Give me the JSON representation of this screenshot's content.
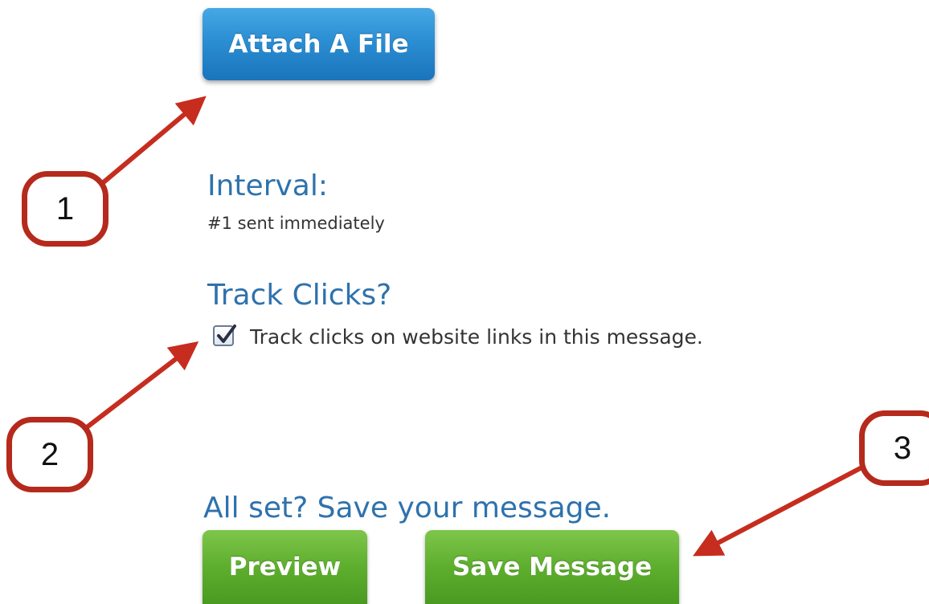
{
  "attach_button": {
    "label": "Attach A File"
  },
  "interval": {
    "heading": "Interval:",
    "value": "#1 sent immediately"
  },
  "track_clicks": {
    "heading": "Track Clicks?",
    "checkbox_label": "Track clicks on website links in this message.",
    "checked": true
  },
  "save_section": {
    "heading": "All set? Save your message.",
    "preview_label": "Preview",
    "save_label": "Save Message"
  },
  "callouts": [
    {
      "number": "1"
    },
    {
      "number": "2"
    },
    {
      "number": "3"
    }
  ],
  "colors": {
    "heading": "#2e72ad",
    "blue_button": "#2b8ed3",
    "green_button": "#5eae2e",
    "annotation": "#c62d1f"
  }
}
